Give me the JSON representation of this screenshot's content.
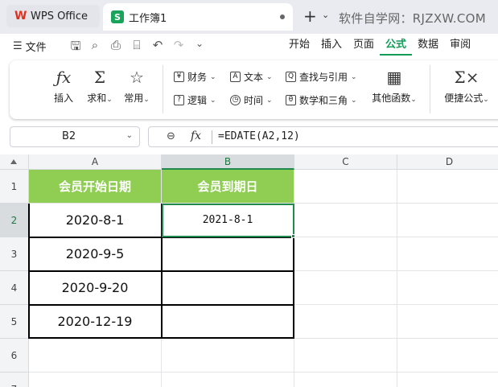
{
  "titlebar": {
    "app_tab": "WPS Office",
    "doc_tab": "工作簿1",
    "new_tab": "+",
    "watermark": "软件自学网：RJZXW.COM"
  },
  "menubar": {
    "file": "文件",
    "tabs": [
      "开始",
      "插入",
      "页面",
      "公式",
      "数据",
      "审阅"
    ],
    "active_tab": "公式"
  },
  "ribbon": {
    "insert": "插入",
    "sum": "求和",
    "common": "常用",
    "finance": "财务",
    "text": "文本",
    "lookup": "查找与引用",
    "logic": "逻辑",
    "time": "时间",
    "math": "数学和三角",
    "other": "其他函数",
    "quick": "便捷公式"
  },
  "formula_bar": {
    "name_box": "B2",
    "formula": "=EDATE(A2,12)"
  },
  "sheet": {
    "columns": [
      "A",
      "B",
      "C",
      "D"
    ],
    "selected_column": "B",
    "rows": [
      "1",
      "2",
      "3",
      "4",
      "5",
      "6",
      "7"
    ],
    "selected_row": "2",
    "header_a": "会员开始日期",
    "header_b": "会员到期日",
    "a_values": [
      "2020-8-1",
      "2020-9-5",
      "2020-9-20",
      "2020-12-19"
    ],
    "b2": "2021-8-1"
  },
  "colors": {
    "accent": "#129c58",
    "header_fill": "#8fcd53",
    "selection": "#1f8a4c"
  }
}
